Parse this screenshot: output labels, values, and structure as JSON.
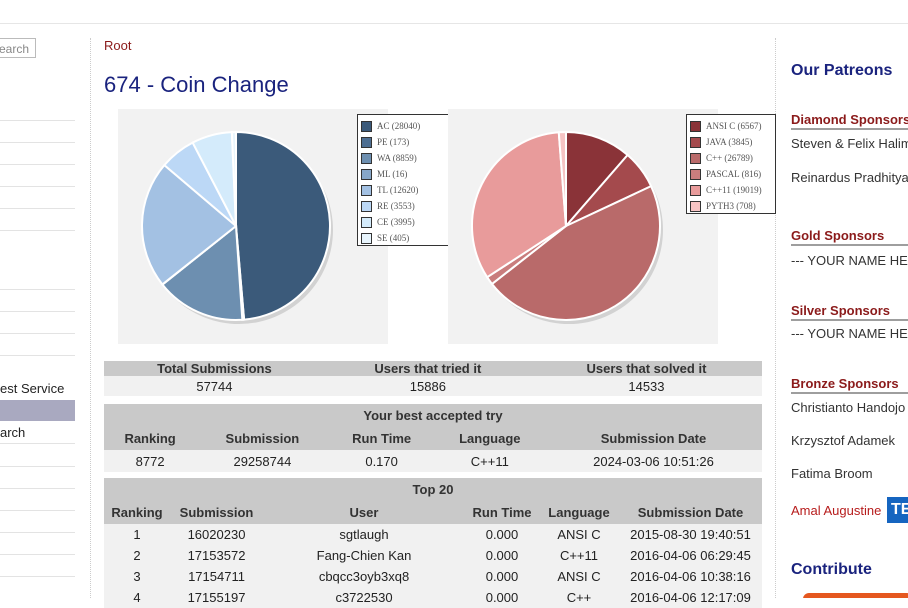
{
  "nav": {
    "search_placeholder": "earch",
    "item_best_service": "est Service",
    "item_search": "arch"
  },
  "breadcrumb": "Root",
  "problem_title": "674 - Coin Change",
  "verdict_chart": {
    "legend": [
      {
        "label": "AC (28040)",
        "color": "#3b5a7a"
      },
      {
        "label": "PE (173)",
        "color": "#4d6e91"
      },
      {
        "label": "WA (8859)",
        "color": "#6d8fb0"
      },
      {
        "label": "ML (16)",
        "color": "#86a6c8"
      },
      {
        "label": "TL (12620)",
        "color": "#a3c1e3"
      },
      {
        "label": "RE (3553)",
        "color": "#bcd8f6"
      },
      {
        "label": "CE (3995)",
        "color": "#d4ebfb"
      },
      {
        "label": "SE (405)",
        "color": "#e8f5fd"
      }
    ]
  },
  "language_chart": {
    "legend": [
      {
        "label": "ANSI C (6567)",
        "color": "#8a3338"
      },
      {
        "label": "JAVA (3845)",
        "color": "#a44a4d"
      },
      {
        "label": "C++ (26789)",
        "color": "#b96a6a"
      },
      {
        "label": "PASCAL (816)",
        "color": "#c97d7d"
      },
      {
        "label": "C++11 (19019)",
        "color": "#e89b9b"
      },
      {
        "label": "PYTH3 (708)",
        "color": "#f6c4c4"
      }
    ]
  },
  "chart_data": [
    {
      "type": "pie",
      "labels": [
        "AC",
        "PE",
        "WA",
        "ML",
        "TL",
        "RE",
        "CE",
        "SE"
      ],
      "values": [
        28040,
        173,
        8859,
        16,
        12620,
        3553,
        3995,
        405
      ]
    },
    {
      "type": "pie",
      "labels": [
        "ANSI C",
        "JAVA",
        "C++",
        "PASCAL",
        "C++11",
        "PYTH3"
      ],
      "values": [
        6567,
        3845,
        26789,
        816,
        19019,
        708
      ]
    }
  ],
  "summary": {
    "headers": [
      "Total Submissions",
      "Users that tried it",
      "Users that solved it"
    ],
    "values": [
      "57744",
      "15886",
      "14533"
    ]
  },
  "best_try": {
    "caption": "Your best accepted try",
    "headers": [
      "Ranking",
      "Submission",
      "Run Time",
      "Language",
      "Submission Date"
    ],
    "row": [
      "8772",
      "29258744",
      "0.170",
      "C++11",
      "2024-03-06 10:51:26"
    ]
  },
  "top20": {
    "caption": "Top 20",
    "headers": [
      "Ranking",
      "Submission",
      "User",
      "Run Time",
      "Language",
      "Submission Date"
    ],
    "rows": [
      [
        "1",
        "16020230",
        "sgtlaugh",
        "0.000",
        "ANSI C",
        "2015-08-30 19:40:51"
      ],
      [
        "2",
        "17153572",
        "Fang-Chien Kan",
        "0.000",
        "C++11",
        "2016-04-06 06:29:45"
      ],
      [
        "3",
        "17154711",
        "cbqcc3oyb3xq8",
        "0.000",
        "ANSI C",
        "2016-04-06 10:38:16"
      ],
      [
        "4",
        "17155197",
        "c3722530",
        "0.000",
        "C++",
        "2016-04-06 12:17:09"
      ]
    ]
  },
  "sidebar": {
    "patreons_title": "Our Patreons",
    "diamond_title": "Diamond Sponsors",
    "diamond_1": "Steven & Felix Halim",
    "diamond_2": "Reinardus Pradhitya",
    "gold_title": "Gold Sponsors",
    "gold_1": "--- YOUR NAME HERE ---",
    "silver_title": "Silver Sponsors",
    "silver_1": "--- YOUR NAME HERE ---",
    "bronze_title": "Bronze Sponsors",
    "bronze_1": "Christianto Handojo",
    "bronze_2": "Krzysztof Adamek",
    "bronze_3": "Fatima Broom",
    "amal": "Amal Augustine",
    "badge": "TE",
    "contribute_title": "Contribute"
  }
}
